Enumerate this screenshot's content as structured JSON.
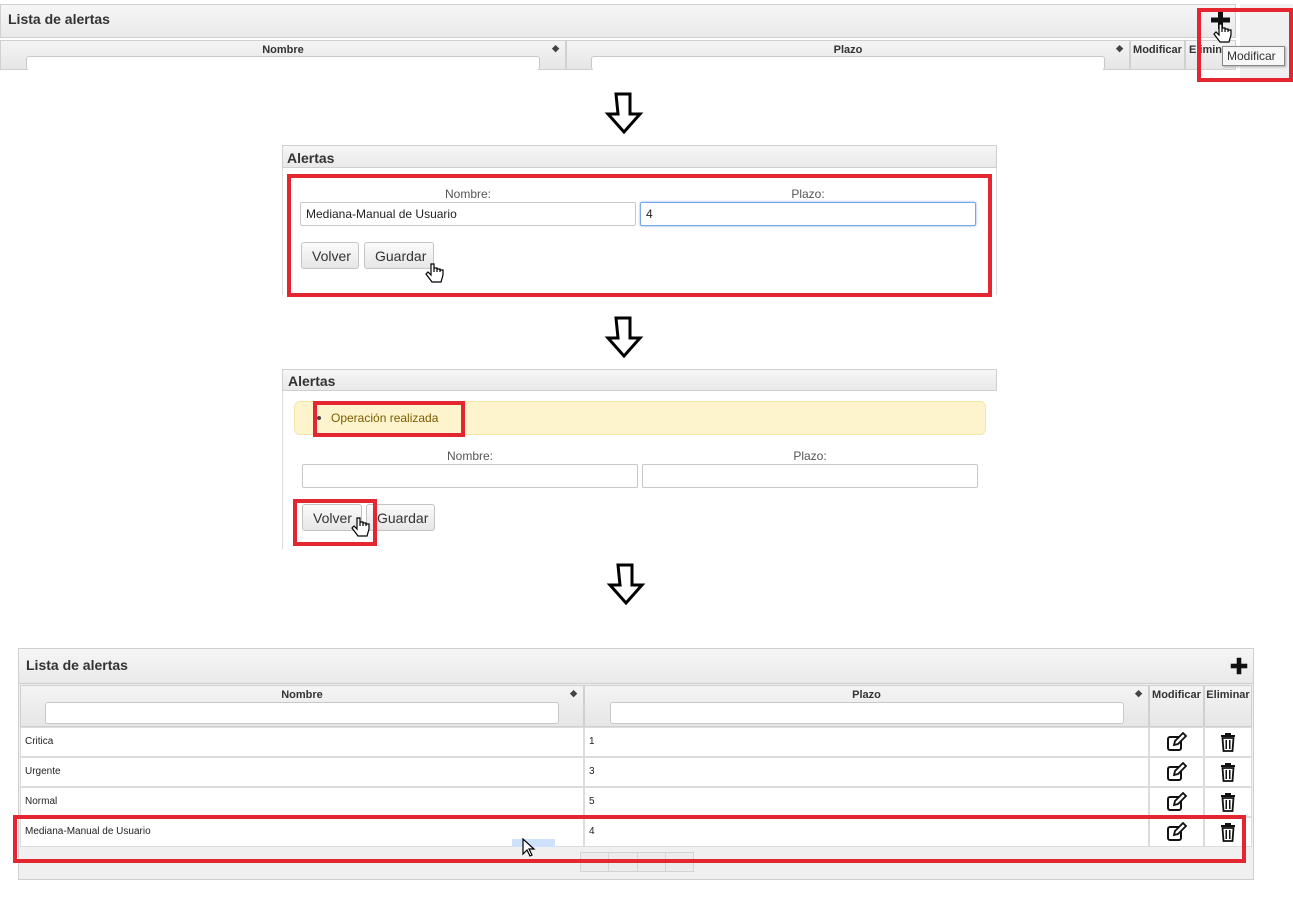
{
  "step1": {
    "title": "Lista de alertas",
    "columns": [
      "Nombre",
      "Plazo",
      "Modificar",
      "Elimina"
    ],
    "tooltip": "Modificar"
  },
  "step2": {
    "title": "Alertas",
    "nombre_label": "Nombre:",
    "plazo_label": "Plazo:",
    "nombre_value": "Mediana-Manual de Usuario",
    "plazo_value": "4",
    "volver": "Volver",
    "guardar": "Guardar"
  },
  "step3": {
    "title": "Alertas",
    "message": "Operación realizada",
    "nombre_label": "Nombre:",
    "plazo_label": "Plazo:",
    "volver": "Volver",
    "guardar": "Guardar"
  },
  "step4": {
    "title": "Lista de alertas",
    "columns": [
      "Nombre",
      "Plazo",
      "Modificar",
      "Eliminar"
    ],
    "rows": [
      {
        "nombre": "Critica",
        "plazo": "1"
      },
      {
        "nombre": "Urgente",
        "plazo": "3"
      },
      {
        "nombre": "Normal",
        "plazo": "5"
      },
      {
        "nombre": "Mediana-Manual de Usuario",
        "plazo": "4"
      }
    ]
  },
  "colors": {
    "highlight": "#e3262f",
    "message_bg": "#fdf3cd",
    "message_text": "#7a5c00"
  }
}
